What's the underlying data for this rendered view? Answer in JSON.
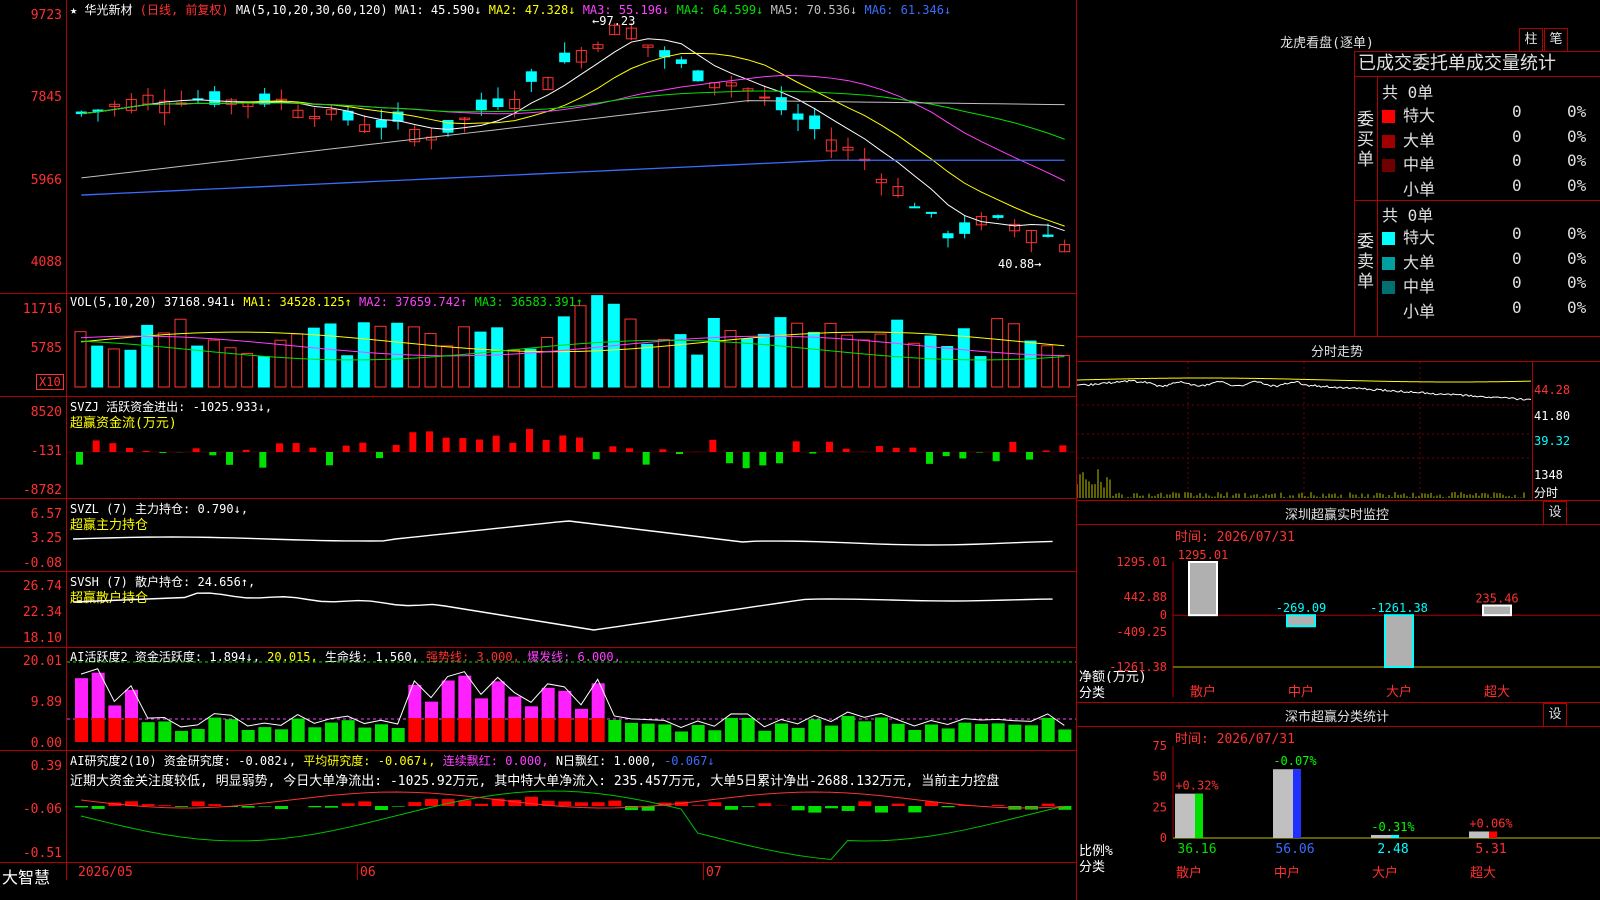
{
  "stock": {
    "name": "华光新材",
    "mode": "(日线, 前复权)",
    "ma_label": "MA(5,10,20,30,60,120)",
    "ma": [
      {
        "label": "MA1: 45.590↓",
        "color": "#ffffff"
      },
      {
        "label": "MA2: 47.328↓",
        "color": "#ffff00"
      },
      {
        "label": "MA3: 55.196↓",
        "color": "#ff40ff"
      },
      {
        "label": "MA4: 64.599↓",
        "color": "#00e000"
      },
      {
        "label": "MA5: 70.536↓",
        "color": "#c0c0c0"
      },
      {
        "label": "MA6: 61.346↓",
        "color": "#3a6dff"
      }
    ],
    "price_axis": [
      "9723",
      "7845",
      "5966",
      "4088"
    ],
    "high_marker": "97.23",
    "low_marker": "40.88"
  },
  "volume": {
    "header": "VOL(5,10,20)",
    "value": "37168.941↓",
    "ma1": "MA1: 34528.125↑",
    "ma2": "MA2: 37659.742↑",
    "ma3": "MA3: 36583.391↑",
    "axis": [
      "11716",
      "5785"
    ],
    "unit_badge": "X10"
  },
  "svzj": {
    "header": "SVZJ  活跃资金进出: -1025.933↓,",
    "sub": "超赢资金流(万元)",
    "axis": [
      "8520",
      "-131",
      "-8782"
    ]
  },
  "svzl": {
    "header": "SVZL (7) 主力持仓: 0.790↓,",
    "sub": "超赢主力持仓",
    "axis": [
      "6.57",
      "3.25",
      "-0.08"
    ]
  },
  "svsh": {
    "header": "SVSH (7) 散户持仓: 24.656↑,",
    "sub": "超赢散户持仓",
    "axis": [
      "26.74",
      "22.34",
      "18.10"
    ]
  },
  "ai_active": {
    "header_a": "AI活跃度2 资金活跃度: 1.894↓,",
    "header_b": "20.015,",
    "header_c": "生命线: 1.560,",
    "header_d": "强势线: 3.000,",
    "header_e": "爆发线: 6.000,",
    "axis": [
      "20.01",
      "9.89",
      "0.00"
    ]
  },
  "ai_research": {
    "header_a": "AI研究度2(10) 资金研究度: -0.082↓,",
    "header_b": "平均研究度: -0.067↓,",
    "header_c": "连续飘红: 0.000,",
    "header_d": "N日飘红: 1.000,",
    "header_e": "-0.067↓",
    "comment": "近期大资金关注度较低, 明显弱势, 今日大单净流出: -1025.92万元, 其中特大单净流入: 235.457万元, 大单5日累计净出-2688.132万元, 当前主力控盘",
    "axis": [
      "0.39",
      "-0.06",
      "-0.51"
    ]
  },
  "date_axis": [
    "2026/05",
    "06",
    "07"
  ],
  "brand": "大智慧",
  "dragon": {
    "title": "龙虎看盘(逐单)",
    "btn1": "柱",
    "btn2": "笔",
    "tabs": "已成交委托单成交量统计",
    "buy_label": "委买单",
    "sell_label": "委卖单",
    "buy_total": "共 0单",
    "sell_total": "共 0单",
    "buy_rows": [
      {
        "name": "特大",
        "count": "0",
        "pct": "0%",
        "color": "#ff0000"
      },
      {
        "name": "大单",
        "count": "0",
        "pct": "0%",
        "color": "#a00000"
      },
      {
        "name": "中单",
        "count": "0",
        "pct": "0%",
        "color": "#700000"
      },
      {
        "name": "小单",
        "count": "0",
        "pct": "0%",
        "color": ""
      }
    ],
    "sell_rows": [
      {
        "name": "特大",
        "count": "0",
        "pct": "0%",
        "color": "#00ffff"
      },
      {
        "name": "大单",
        "count": "0",
        "pct": "0%",
        "color": "#00a0a0"
      },
      {
        "name": "中单",
        "count": "0",
        "pct": "0%",
        "color": "#007070"
      },
      {
        "name": "小单",
        "count": "0",
        "pct": "0%",
        "color": ""
      }
    ]
  },
  "minute": {
    "title": "分时走势",
    "axis": [
      "44.28",
      "41.80",
      "39.32",
      "1348"
    ],
    "unit": "分时"
  },
  "realtime": {
    "title": "深圳超赢实时监控",
    "btn": "设",
    "time": "时间: 2026/07/31",
    "axis": [
      "1295.01",
      "442.88",
      "0",
      "-409.25",
      "-1261.38"
    ],
    "ylabel": "净额(万元)",
    "xlabel": "分类",
    "categories": [
      "散户",
      "中户",
      "大户",
      "超大"
    ],
    "values": [
      1295.01,
      -269.09,
      -1261.38,
      235.46
    ],
    "value_labels": [
      "1295.01",
      "-269.09",
      "-1261.38",
      "235.46"
    ]
  },
  "classify": {
    "title": "深市超赢分类统计",
    "btn": "设",
    "time": "时间: 2026/07/31",
    "axis": [
      "75",
      "50",
      "25",
      "0"
    ],
    "ylabel": "比例%",
    "xlabel": "分类",
    "categories": [
      "散户",
      "中户",
      "大户",
      "超大"
    ],
    "values": [
      36.16,
      56.06,
      2.48,
      5.31
    ],
    "value_labels": [
      "36.16",
      "56.06",
      "2.48",
      "5.31"
    ],
    "change_labels": [
      "+0.32%",
      "-0.07%",
      "-0.31%",
      "+0.06%"
    ]
  },
  "colors": {
    "up": "#ff3232",
    "down": "#00ffff",
    "frame": "#b00000"
  }
}
